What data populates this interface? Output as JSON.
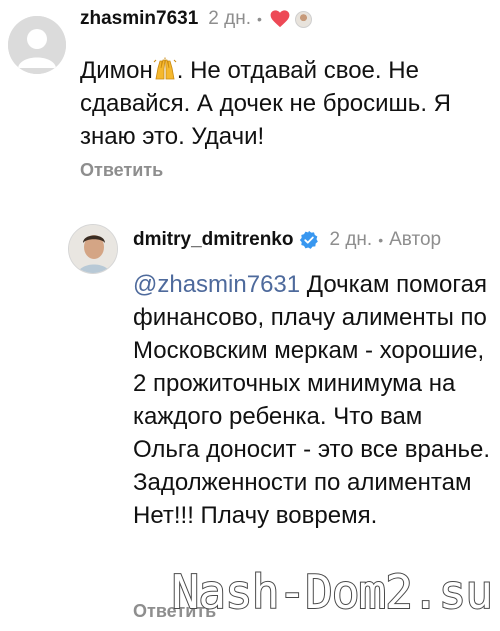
{
  "comment": {
    "username": "zhasmin7631",
    "time": "2 дн.",
    "separator": "•",
    "text_before_emoji": "Димон",
    "emoji": "raising-hands",
    "text_after_emoji": ". Не отдавай свое. Не сдавайся. А дочек не бросишь. Я знаю это. Удачи!",
    "reply_label": "Ответить",
    "liked_by_author_icon": "heart-icon",
    "like_color": "#ed4956"
  },
  "reply": {
    "username": "dmitry_dmitrenko",
    "verified_icon": "verified-badge-icon",
    "verified_color": "#3897f0",
    "time": "2 дн.",
    "separator": "•",
    "author_label": "Автор",
    "mention": "@zhasmin7631",
    "text": " Дочкам помогая финансово, плачу алименты по Московским меркам - хорошие, 2 прожиточных минимума на каждого ребенка. Что вам Ольга доносит - это все вранье. Задолженности по алиментам Нет!!! Плачу вовремя.",
    "reply_label": "Ответить",
    "mention_color": "#4e6a9c"
  },
  "watermark": "Nash-Dom2.su"
}
